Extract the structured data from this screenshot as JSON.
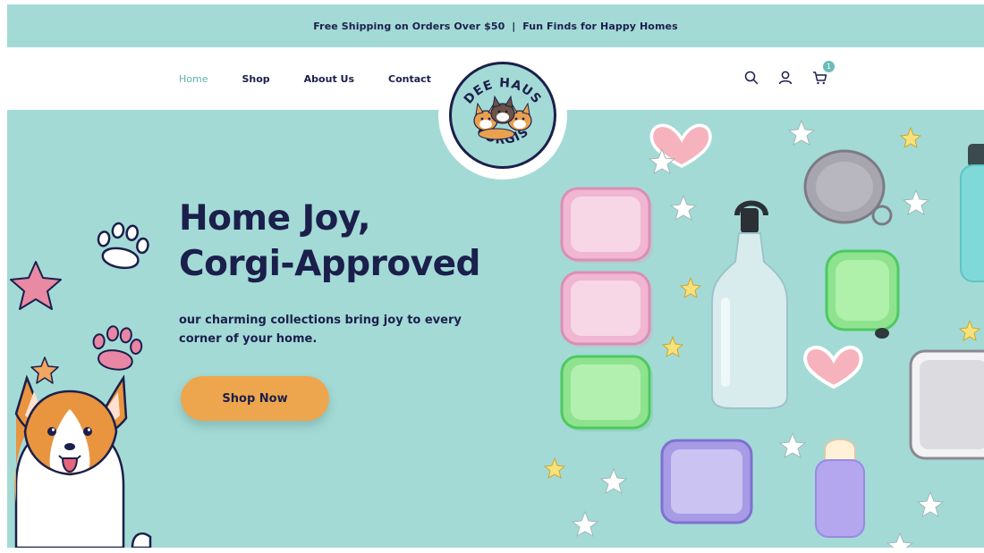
{
  "announcement": "Free Shipping on Orders Over $50  |  Fun Finds for Happy Homes",
  "nav": [
    {
      "label": "Home",
      "active": true
    },
    {
      "label": "Shop",
      "active": false
    },
    {
      "label": "About Us",
      "active": false
    },
    {
      "label": "Contact",
      "active": false
    }
  ],
  "logo": {
    "top_text": "DEE HAUS",
    "bottom_text": "CORGIS"
  },
  "cart": {
    "count": "1"
  },
  "hero": {
    "title_line1": "Home Joy,",
    "title_line2": "Corgi-Approved",
    "subtitle": "our charming collections bring joy to every corner of your home.",
    "cta_label": "Shop Now"
  },
  "colors": {
    "brand_teal": "#a3dad6",
    "navy": "#1b1f4b",
    "cta_orange": "#eda64d",
    "active_link": "#5fb1ab"
  },
  "icons": [
    "search-icon",
    "user-icon",
    "cart-icon"
  ]
}
